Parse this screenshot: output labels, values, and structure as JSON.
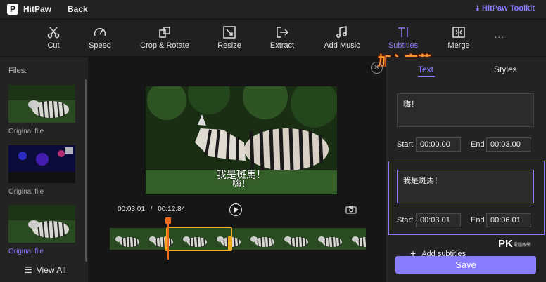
{
  "titlebar": {
    "logo_letter": "P",
    "app_name": "HitPaw",
    "back_label": "Back",
    "toolkit_label": "HitPaw Toolkit"
  },
  "toolbar": {
    "tools": [
      {
        "label": "Cut",
        "icon": "scissors-icon"
      },
      {
        "label": "Speed",
        "icon": "speedometer-icon"
      },
      {
        "label": "Crop & Rotate",
        "icon": "crop-rotate-icon"
      },
      {
        "label": "Resize",
        "icon": "resize-icon"
      },
      {
        "label": "Extract",
        "icon": "extract-icon"
      },
      {
        "label": "Add Music",
        "icon": "music-note-icon"
      },
      {
        "label": "Subtitles",
        "icon": "text-cursor-icon",
        "active": true
      },
      {
        "label": "Merge",
        "icon": "merge-icon"
      }
    ],
    "more_label": "...",
    "callout": "加入字幕"
  },
  "files": {
    "title": "Files:",
    "items": [
      {
        "label": "Original file",
        "selected": false
      },
      {
        "label": "Original file",
        "selected": false
      },
      {
        "label": "Original file",
        "selected": true
      }
    ],
    "view_all_label": "View All"
  },
  "preview": {
    "subtitle_overlay": "我是斑馬！",
    "current_time": "00:03.01",
    "total_time": "00:12.84",
    "time_separator": "/"
  },
  "subtitle_panel": {
    "tabs": [
      {
        "label": "Text",
        "active": true
      },
      {
        "label": "Styles",
        "active": false
      }
    ],
    "entries": [
      {
        "text": "嗨！",
        "start_label": "Start",
        "start": "00:00.00",
        "end_label": "End",
        "end": "00:03.00",
        "active": false
      },
      {
        "text": "我是斑馬！",
        "start_label": "Start",
        "start": "00:03.01",
        "end_label": "End",
        "end": "00:06.01",
        "active": true
      }
    ],
    "add_label": "Add subtitles",
    "save_label": "Save"
  },
  "watermark": {
    "main": "PK",
    "small": "電腦教學"
  },
  "colors": {
    "accent": "#8a7cff",
    "timeline_select": "#f5a623",
    "playhead": "#f06a1a",
    "callout": "#ff9a3a"
  }
}
